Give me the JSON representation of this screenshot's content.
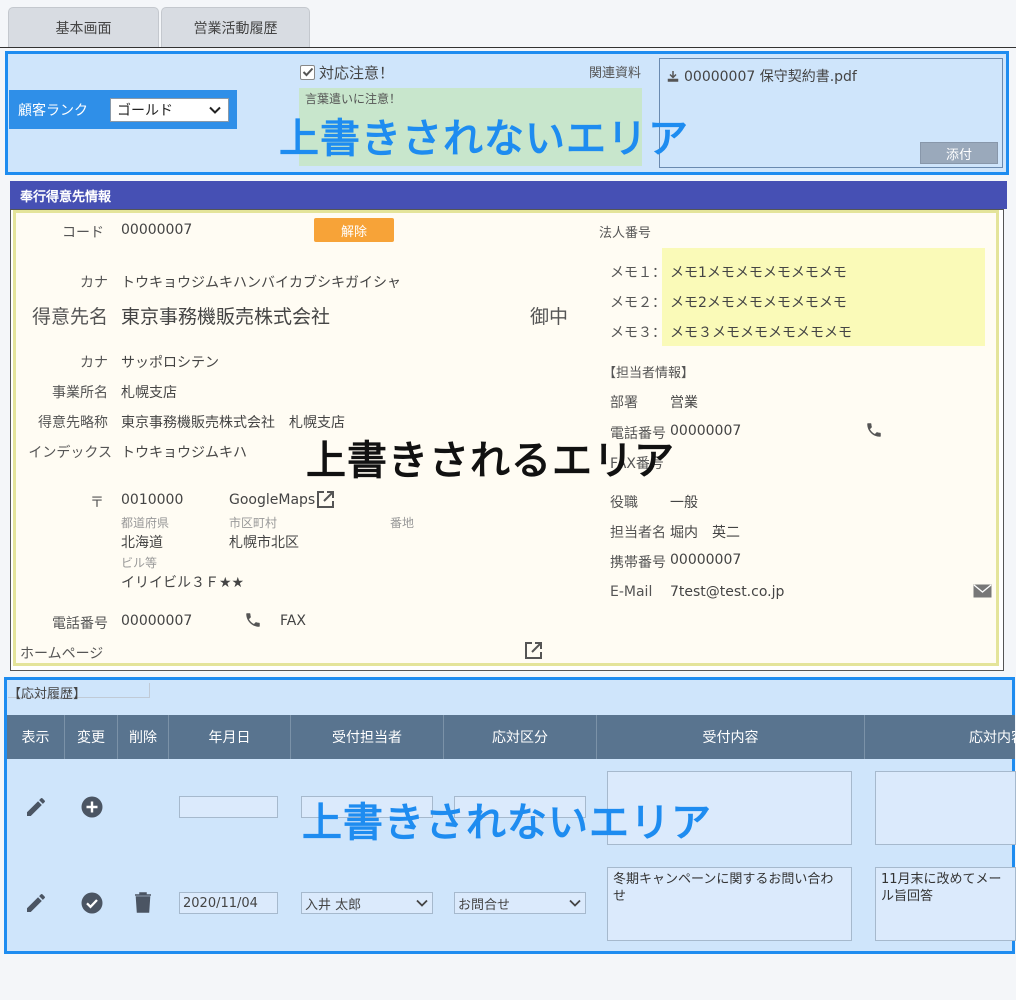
{
  "tabs": [
    {
      "label": "基本画面"
    },
    {
      "label": "営業活動履歴"
    }
  ],
  "top_area": {
    "rank_label": "顧客ランク",
    "rank_value": "ゴールド",
    "caution_label": "対応注意！",
    "caution_checked": true,
    "caution_note": "言葉遣いに注意！",
    "related_label": "関連資料",
    "file_name": "00000007 保守契約書.pdf",
    "attach_label": "添付",
    "overlay": "上書きされないエリア"
  },
  "customer": {
    "section_title": "奉行得意先情報",
    "code_label": "コード",
    "code_value": "00000007",
    "release_label": "解除",
    "kana_label": "カナ",
    "kana_value": "トウキョウジムキハンバイカブシキガイシャ",
    "name_label": "得意先名",
    "name_value": "東京事務機販売株式会社",
    "honorific": "御中",
    "office_kana_label": "カナ",
    "office_kana_value": "サッポロシテン",
    "office_label": "事業所名",
    "office_value": "札幌支店",
    "short_label": "得意先略称",
    "short_value": "東京事務機販売株式会社　札幌支店",
    "index_label": "インデックス",
    "index_value": "トウキョウジムキハ",
    "zip_label": "〒",
    "zip_value": "0010000",
    "maps_label": "GoogleMaps",
    "pref_label": "都道府県",
    "pref_value": "北海道",
    "city_label": "市区町村",
    "city_value": "札幌市北区",
    "block_label": "番地",
    "bldg_label": "ビル等",
    "bldg_value": "イリイビル３Ｆ★★",
    "tel_label": "電話番号",
    "tel_value": "00000007",
    "fax_label": "FAX",
    "hp_label": "ホームページ",
    "corp_no_label": "法人番号",
    "memos": [
      {
        "label": "メモ１：",
        "value": "メモ1メモメモメモメモメモ"
      },
      {
        "label": "メモ２：",
        "value": "メモ2メモメモメモメモメモ"
      },
      {
        "label": "メモ３：",
        "value": "メモ３メモメモメモメモメモ"
      }
    ],
    "contact_header": "【担当者情報】",
    "dept_label": "部署",
    "dept_value": "営業",
    "ctel_label": "電話番号",
    "ctel_value": "00000007",
    "cfax_label": "FAX番号",
    "role_label": "役職",
    "role_value": "一般",
    "person_label": "担当者名",
    "person_value": "堀内　英二",
    "mobile_label": "携帯番号",
    "mobile_value": "00000007",
    "email_label": "E-Mail",
    "email_value": "7test@test.co.jp",
    "overlay": "上書きされるエリア"
  },
  "history": {
    "label": "【応対履歴】",
    "columns": [
      "表示",
      "変更",
      "削除",
      "年月日",
      "受付担当者",
      "応対区分",
      "受付内容",
      "応対内容"
    ],
    "rows": [
      {
        "date": "",
        "staff": "",
        "type": "",
        "content": "",
        "response": ""
      },
      {
        "date": "2020/11/04",
        "staff": "入井 太郎",
        "type": "お問合せ",
        "content": "冬期キャンペーンに関するお問い合わせ",
        "response": "11月末に改めてメール旨回答"
      }
    ],
    "overlay": "上書きされないエリア"
  },
  "colors": {
    "accent": "#1e8cf0",
    "header": "#4650b4",
    "table_header": "#59748f",
    "release": "#f7a338"
  }
}
